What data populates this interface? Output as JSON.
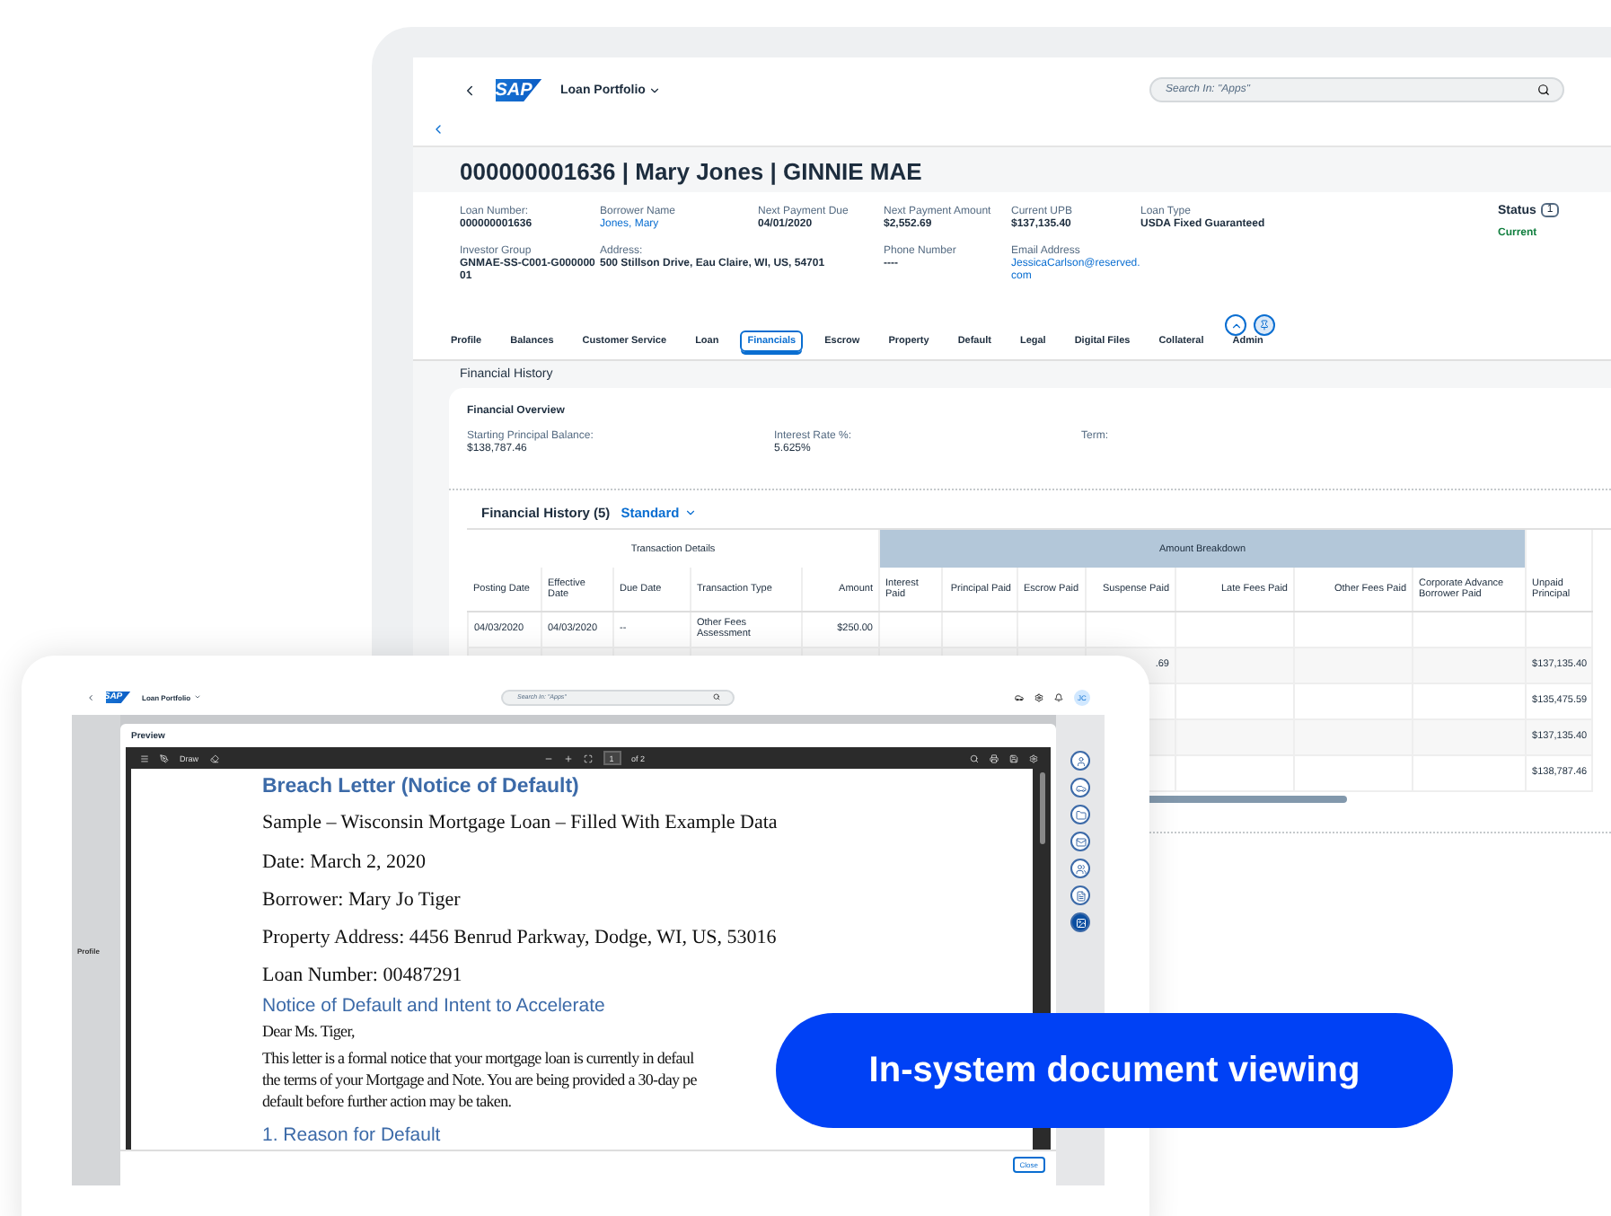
{
  "back_screen": {
    "logo_text": "SAP",
    "app_title": "Loan Portfolio",
    "search": {
      "placeholder": "Search In: \"Apps\""
    },
    "page_title": "000000001636 | Mary Jones | GINNIE MAE",
    "header_rows": [
      [
        {
          "label": "Loan Number:",
          "value": "000000001636",
          "kind": "text"
        },
        {
          "label": "Borrower Name",
          "value": "Jones, Mary",
          "kind": "link"
        },
        {
          "label": "Next Payment Due",
          "value": "04/01/2020",
          "kind": "text"
        },
        {
          "label": "Next Payment Amount",
          "value": "$2,552.69",
          "kind": "text"
        },
        {
          "label": "Current UPB",
          "value": "$137,135.40",
          "kind": "text"
        },
        {
          "label": "Loan Type",
          "value": "USDA Fixed Guaranteed",
          "kind": "text"
        }
      ],
      [
        {
          "label": "Investor Group",
          "value": "GNMAE-SS-C001-G00000001",
          "kind": "text"
        },
        {
          "label": "Address:",
          "value": "500 Stillson Drive, Eau Claire, WI, US, 54701",
          "kind": "text"
        },
        null,
        {
          "label": "Phone Number",
          "value": "----",
          "kind": "text"
        },
        {
          "label": "Email Address",
          "value": "JessicaCarlson@reserved.com",
          "kind": "link"
        }
      ]
    ],
    "status": {
      "label": "Status",
      "count": "1",
      "value": "Current"
    },
    "tabs": [
      {
        "label": "Profile",
        "selected": false
      },
      {
        "label": "Balances",
        "selected": false
      },
      {
        "label": "Customer Service",
        "selected": false
      },
      {
        "label": "Loan",
        "selected": false
      },
      {
        "label": "Financials",
        "selected": true
      },
      {
        "label": "Escrow",
        "selected": false
      },
      {
        "label": "Property",
        "selected": false
      },
      {
        "label": "Default",
        "selected": false
      },
      {
        "label": "Legal",
        "selected": false
      },
      {
        "label": "Digital Files",
        "selected": false
      },
      {
        "label": "Collateral",
        "selected": false
      },
      {
        "label": "Admin",
        "selected": false
      }
    ],
    "section_title": "Financial History",
    "overview": {
      "title": "Financial Overview",
      "fields": [
        {
          "label": "Starting Principal Balance:",
          "value": "$138,787.46"
        },
        {
          "label": "Interest Rate %:",
          "value": "5.625%"
        },
        {
          "label": "Term:"
        }
      ]
    },
    "table": {
      "title": "Financial History (5)",
      "variant": "Standard",
      "groups": [
        {
          "label": "Transaction Details",
          "highlighted": false,
          "columns": [
            "Posting Date",
            "Effective Date",
            "Due Date",
            "Transaction Type",
            "Amount"
          ]
        },
        {
          "label": "Amount Breakdown",
          "highlighted": true,
          "columns": [
            "Interest Paid",
            "Principal Paid",
            "Escrow Paid",
            "Suspense Paid",
            "Late Fees Paid",
            "Other Fees Paid",
            "Corporate Advance Borrower Paid"
          ]
        },
        {
          "highlighted": false,
          "columns": [
            "Unpaid Principal"
          ]
        }
      ],
      "rows": [
        [
          "04/03/2020",
          "04/03/2020",
          "--",
          "Other Fees Assessment",
          "$250.00",
          null,
          null,
          null,
          null,
          null,
          null,
          null,
          null
        ],
        [
          null,
          null,
          null,
          null,
          null,
          null,
          null,
          null,
          ".69",
          null,
          null,
          null,
          "$137,135.40"
        ],
        [
          null,
          null,
          null,
          null,
          null,
          null,
          null,
          null,
          null,
          null,
          null,
          null,
          "$135,475.59"
        ],
        [
          null,
          null,
          null,
          null,
          null,
          null,
          null,
          null,
          null,
          null,
          null,
          null,
          "$137,135.40"
        ],
        [
          null,
          null,
          null,
          null,
          null,
          null,
          null,
          null,
          null,
          null,
          null,
          null,
          "$138,787.46"
        ]
      ]
    }
  },
  "front_screen": {
    "logo_text": "SAP",
    "app_title": "Loan Portfolio",
    "search": {
      "placeholder": "Search In: \"Apps\""
    },
    "avatar": "JC",
    "side_label": "Profile",
    "preview": {
      "title": "Preview",
      "toolbar": {
        "draw": "Draw",
        "page": "1",
        "page_count": "of 2"
      },
      "document": [
        {
          "kind": "title",
          "text": "Breach Letter (Notice of Default)"
        },
        {
          "kind": "subtitle",
          "text": "Sample – Wisconsin Mortgage Loan – Filled With Example Data"
        },
        {
          "kind": "para",
          "text": "Date: March 2, 2020"
        },
        {
          "kind": "para",
          "text": "Borrower: Mary Jo Tiger"
        },
        {
          "kind": "para",
          "text": "Property Address: 4456 Benrud Parkway, Dodge, WI, US, 53016"
        },
        {
          "kind": "para",
          "text": "Loan Number: 00487291"
        },
        {
          "kind": "heading",
          "text": "Notice of Default and Intent to Accelerate"
        },
        {
          "kind": "line",
          "text": "Dear Ms. Tiger,"
        },
        {
          "kind": "gap"
        },
        {
          "kind": "line",
          "text": "This letter is a formal notice that your mortgage loan is currently in defaul"
        },
        {
          "kind": "line",
          "text": "the terms of your Mortgage and Note. You are being provided a 30-day pe"
        },
        {
          "kind": "line",
          "text": "default before further action may be taken."
        },
        {
          "kind": "heading",
          "text": "1. Reason for Default"
        }
      ],
      "close": "Close"
    }
  },
  "caption": "In-system document viewing"
}
